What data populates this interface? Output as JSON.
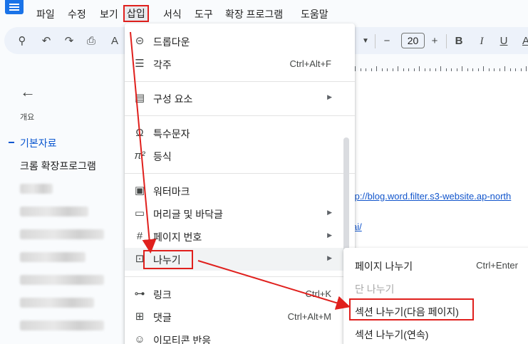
{
  "menubar": {
    "items": [
      "파일",
      "수정",
      "보기",
      "삽입",
      "서식",
      "도구",
      "확장 프로그램",
      "도움말"
    ],
    "active_index": 3
  },
  "toolbar": {
    "font_size": "20",
    "icons": [
      "search-icon",
      "undo-icon",
      "redo-icon",
      "print-icon",
      "spellcheck-icon",
      "minus-icon",
      "bold-icon",
      "italic-icon",
      "underline-icon",
      "text-color-icon"
    ],
    "bold": "B",
    "italic": "I",
    "underline": "U",
    "text_color": "A"
  },
  "outline": {
    "summary_label": "개요",
    "active_heading": "기본자료",
    "item": "크롬 확장프로그램"
  },
  "document": {
    "link1": "tp://blog.word.filter.s3-website.ap-north",
    "link2": "ai/"
  },
  "insert_menu": {
    "items": [
      {
        "icon": "dropdown-icon",
        "label": "드롭다운",
        "shortcut": ""
      },
      {
        "icon": "footnote-icon",
        "label": "각주",
        "shortcut": "Ctrl+Alt+F"
      },
      {
        "icon": "building-blocks-icon",
        "label": "구성 요소",
        "shortcut": "",
        "submenu": true
      },
      {
        "icon": "omega-icon",
        "label": "특수문자",
        "shortcut": ""
      },
      {
        "icon": "pi-icon",
        "label": "등식",
        "shortcut": ""
      },
      {
        "icon": "watermark-icon",
        "label": "워터마크",
        "shortcut": ""
      },
      {
        "icon": "header-footer-icon",
        "label": "머리글 및 바닥글",
        "shortcut": "",
        "submenu": true
      },
      {
        "icon": "hash-icon",
        "label": "페이지 번호",
        "shortcut": "",
        "submenu": true
      },
      {
        "icon": "break-icon",
        "label": "나누기",
        "shortcut": "",
        "submenu": true
      },
      {
        "icon": "link-icon",
        "label": "링크",
        "shortcut": "Ctrl+K"
      },
      {
        "icon": "comment-icon",
        "label": "댓글",
        "shortcut": "Ctrl+Alt+M"
      },
      {
        "icon": "emoji-icon",
        "label": "이모티콘 반응",
        "shortcut": ""
      }
    ]
  },
  "break_submenu": {
    "items": [
      {
        "label": "페이지 나누기",
        "shortcut": "Ctrl+Enter",
        "disabled": false
      },
      {
        "label": "단 나누기",
        "shortcut": "",
        "disabled": true
      },
      {
        "label": "섹션 나누기(다음 페이지)",
        "shortcut": "",
        "disabled": false
      },
      {
        "label": "섹션 나누기(연속)",
        "shortcut": "",
        "disabled": false
      }
    ]
  },
  "colors": {
    "annotation_red": "#e0201d",
    "link_blue": "#1155cc",
    "accent_blue": "#0b57d0"
  }
}
